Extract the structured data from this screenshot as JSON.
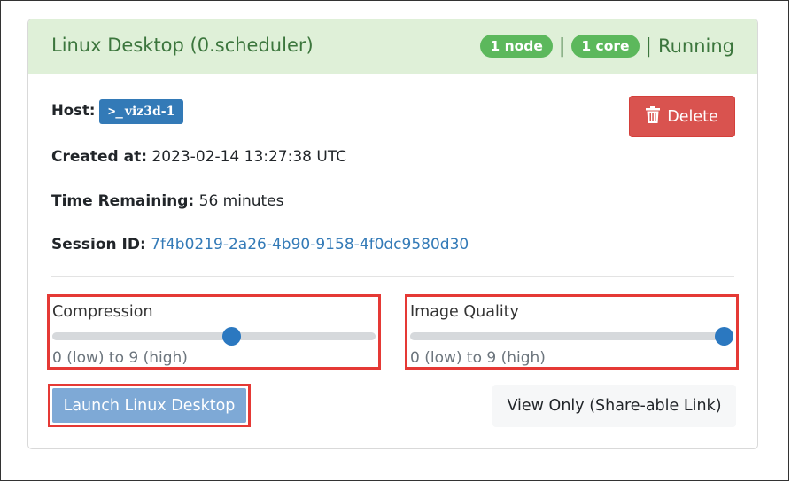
{
  "header": {
    "title": "Linux Desktop (0.scheduler)",
    "nodes_badge": "1 node",
    "cores_badge": "1 core",
    "separator": "|",
    "status": "Running"
  },
  "host": {
    "label": "Host:",
    "badge_icon": ">_",
    "badge_text": "viz3d-1"
  },
  "actions": {
    "delete_label": "Delete",
    "launch_label": "Launch Linux Desktop",
    "view_only_label": "View Only (Share-able Link)"
  },
  "details": {
    "created_label": "Created at:",
    "created_value": "2023-02-14 13:27:38 UTC",
    "time_label": "Time Remaining:",
    "time_value": "56 minutes",
    "session_label": "Session ID:",
    "session_value": "7f4b0219-2a26-4b90-9158-4f0dc9580d30"
  },
  "compression": {
    "label": "Compression",
    "hint": "0 (low) to 9 (high)",
    "min": 0,
    "max": 9,
    "value": 5
  },
  "image_quality": {
    "label": "Image Quality",
    "hint": "0 (low) to 9 (high)",
    "min": 0,
    "max": 9,
    "value": 9
  },
  "colors": {
    "header_bg": "#dff0d8",
    "header_text": "#3c763d",
    "success": "#5cb85c",
    "primary": "#337ab7",
    "danger": "#d9534f",
    "highlight_outline": "#e53935"
  }
}
